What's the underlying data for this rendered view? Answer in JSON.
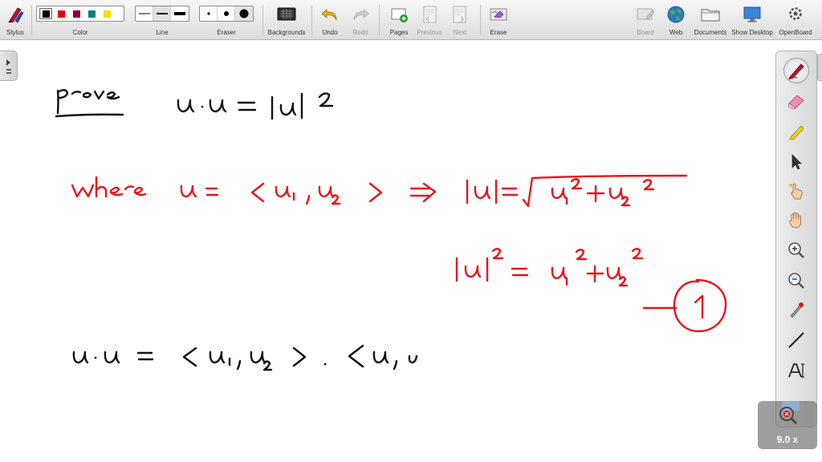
{
  "toolbar": {
    "stylus": "Stylus",
    "color": "Color",
    "line": "Line",
    "eraser": "Eraser",
    "backgrounds": "Backgrounds",
    "undo": "Undo",
    "redo": "Redo",
    "pages": "Pages",
    "previous": "Previous",
    "next": "Next",
    "erase": "Erase",
    "board": "Board",
    "web": "Web",
    "documents": "Documents",
    "show_desktop": "Show Desktop",
    "openboard": "OpenBoard"
  },
  "colors": {
    "palette": [
      "#000000",
      "#e00000",
      "#800040",
      "#008080",
      "#f0e000"
    ],
    "selected_index": 0,
    "ink_black": "#111111",
    "ink_red": "#e8141a"
  },
  "zoom": {
    "label": "9.0 x"
  },
  "icons": [
    "stylus-icon",
    "backgrounds-icon",
    "undo-icon",
    "redo-icon",
    "pages-icon",
    "previous-icon",
    "next-icon",
    "erase-icon",
    "board-icon",
    "web-icon",
    "documents-icon",
    "show-desktop-icon",
    "openboard-icon",
    "pen-icon",
    "eraser-icon",
    "marker-icon",
    "pointer-icon",
    "laser-icon",
    "hand-icon",
    "zoom-in-icon",
    "zoom-out-icon",
    "capture-icon",
    "line-icon",
    "text-icon"
  ]
}
